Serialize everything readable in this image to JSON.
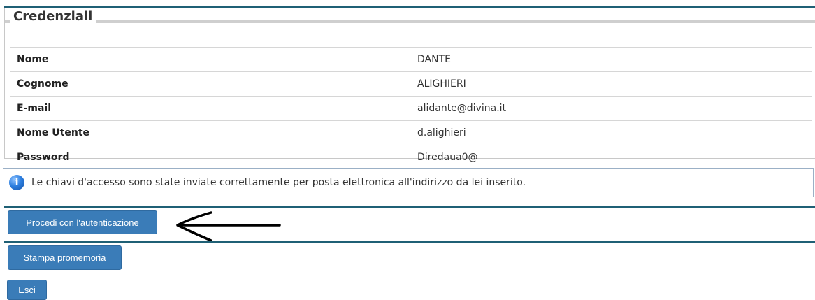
{
  "section": {
    "title": "Credenziali"
  },
  "credentials": [
    {
      "label": "Nome",
      "value": "DANTE"
    },
    {
      "label": "Cognome",
      "value": "ALIGHIERI"
    },
    {
      "label": "E-mail",
      "value": "alidante@divina.it"
    },
    {
      "label": "Nome Utente",
      "value": "d.alighieri"
    },
    {
      "label": "Password",
      "value": "Diredaua0@"
    }
  ],
  "info": {
    "icon": "info-icon",
    "message": "Le chiavi d'accesso sono state inviate correttamente per posta elettronica all'indirizzo da lei inserito."
  },
  "actions": {
    "proceed_label": "Procedi con l'autenticazione",
    "print_label": "Stampa promemoria",
    "exit_label": "Esci"
  },
  "colors": {
    "accent_bar": "#1f6075",
    "button_bg": "#3a7cb8",
    "info_border": "#9bb0c6"
  }
}
